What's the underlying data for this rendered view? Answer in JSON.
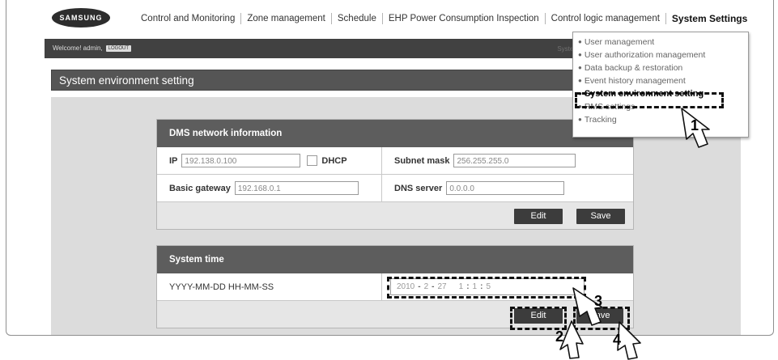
{
  "brand": {
    "logo_text": "SAMSUNG"
  },
  "top_nav": [
    "Control and Monitoring",
    "Zone management",
    "Schedule",
    "EHP Power Consumption Inspection",
    "Control logic management",
    "System Settings"
  ],
  "welcome": {
    "text": "Welcome! admin,",
    "logout_label": "LOGOUT",
    "right_text": "System"
  },
  "page_title": "System environment setting",
  "network": {
    "title": "DMS network information",
    "ip_label": "IP",
    "ip_value": "192.138.0.100",
    "dhcp_label": "DHCP",
    "subnet_label": "Subnet mask",
    "subnet_value": "256.255.255.0",
    "gateway_label": "Basic gateway",
    "gateway_value": "192.168.0.1",
    "dns_label": "DNS server",
    "dns_value": "0.0.0.0",
    "edit_label": "Edit",
    "save_label": "Save"
  },
  "system_time": {
    "title": "System time",
    "format_label": "YYYY-MM-DD HH-MM-SS",
    "year": "2010",
    "month": "2",
    "day": "27",
    "hour": "1",
    "minute": "1",
    "second": "5",
    "sep_date": "-",
    "sep_time": ":",
    "edit_label": "Edit",
    "save_label": "Save"
  },
  "settings_menu": {
    "items": [
      "User management",
      "User authorization management",
      "Data backup & restoration",
      "Event history management",
      "System environment setting",
      "RMS settings",
      "Tracking"
    ],
    "active_index": 4
  },
  "callouts": [
    "1",
    "2",
    "3",
    "4"
  ]
}
